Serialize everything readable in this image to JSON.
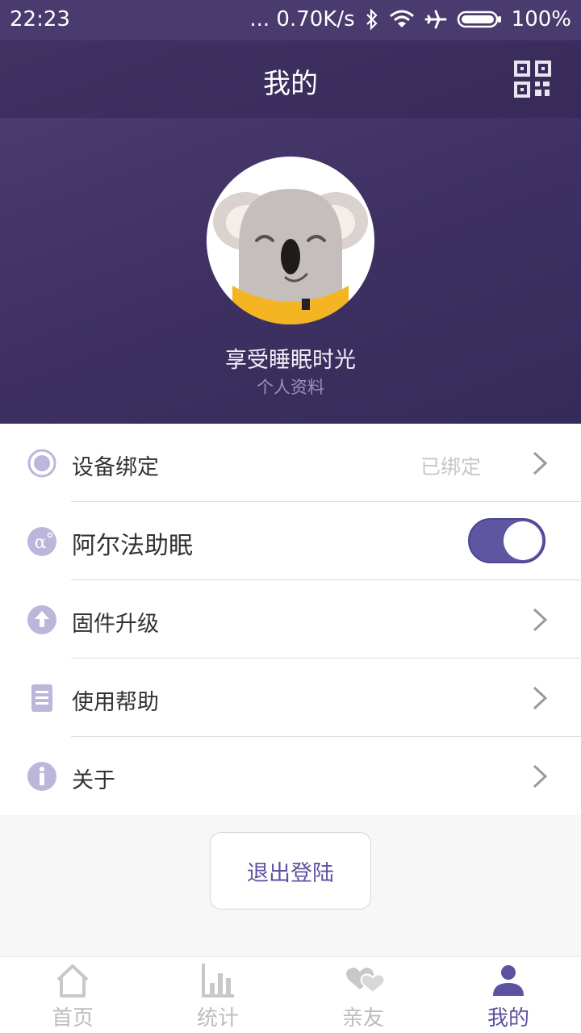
{
  "status_bar": {
    "time": "22:23",
    "network_speed": "... 0.70K/s",
    "battery": "100%"
  },
  "header": {
    "title": "我的",
    "qr_icon": "qr-code-icon"
  },
  "profile": {
    "nickname": "享受睡眠时光",
    "link": "个人资料",
    "avatar_icon": "koala-avatar"
  },
  "menu": {
    "device": {
      "label": "设备绑定",
      "value": "已绑定",
      "icon": "device-ring-icon"
    },
    "alpha": {
      "label": "阿尔法助眠",
      "icon": "alpha-icon",
      "toggle_on": true
    },
    "firmware": {
      "label": "固件升级",
      "icon": "upload-arrow-icon"
    },
    "help": {
      "label": "使用帮助",
      "icon": "document-icon"
    },
    "about": {
      "label": "关于",
      "icon": "info-icon"
    }
  },
  "logout": {
    "label": "退出登陆"
  },
  "tabs": [
    {
      "label": "首页",
      "icon": "home-icon"
    },
    {
      "label": "统计",
      "icon": "bar-chart-icon"
    },
    {
      "label": "亲友",
      "icon": "hearts-icon"
    },
    {
      "label": "我的",
      "icon": "person-icon"
    }
  ],
  "colors": {
    "accent": "#5c53a0",
    "header_bg": "#3e3162",
    "icon_tint": "#bdb5da"
  }
}
